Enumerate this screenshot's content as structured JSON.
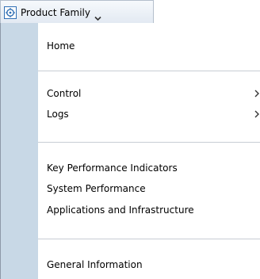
{
  "menu": {
    "header": {
      "label": "Product Family",
      "icon": "target-icon",
      "caret_icon": "chevron-down-icon"
    },
    "items": [
      {
        "label": "Home",
        "has_submenu": false
      },
      {
        "label": "Control",
        "has_submenu": true
      },
      {
        "label": "Logs",
        "has_submenu": true
      },
      {
        "label": "Key Performance Indicators",
        "has_submenu": false
      },
      {
        "label": "System Performance",
        "has_submenu": false
      },
      {
        "label": "Applications and Infrastructure",
        "has_submenu": false
      },
      {
        "label": "General Information",
        "has_submenu": false
      }
    ],
    "colors": {
      "gutter": "#c8d8e6",
      "header_border": "#b4bfcc",
      "separator": "#c7cdd4",
      "icon_blue": "#2f6fb5"
    }
  }
}
